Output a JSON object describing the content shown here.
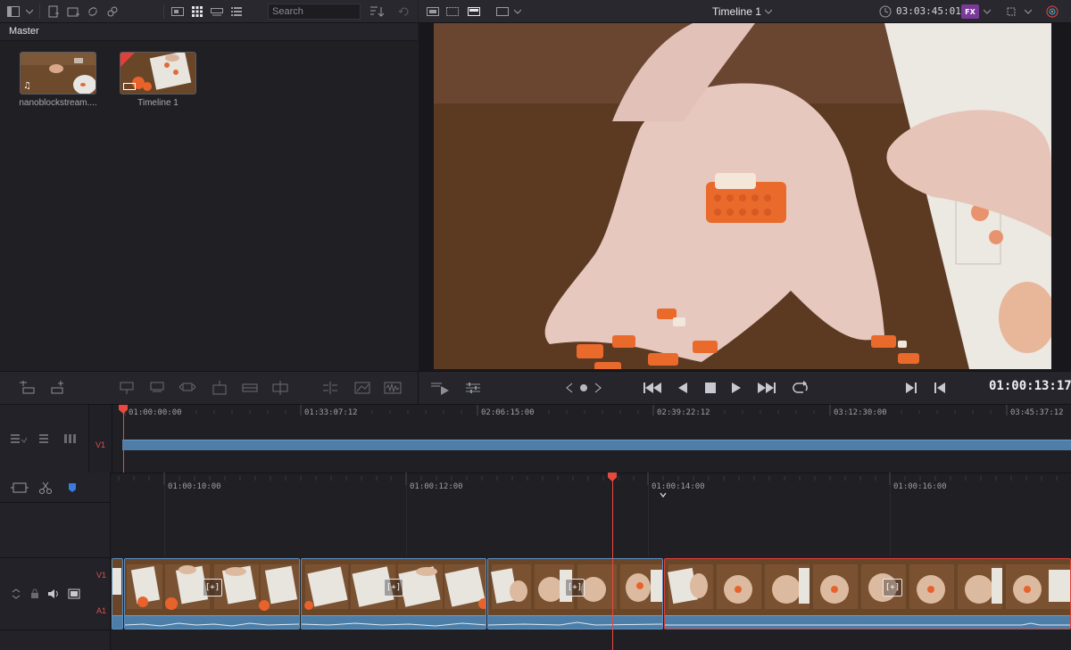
{
  "media_pool": {
    "search_placeholder": "Search",
    "bin_name": "Master",
    "items": [
      {
        "label": "nanoblockstream...."
      },
      {
        "label": "Timeline 1"
      }
    ]
  },
  "viewer": {
    "timeline_name": "Timeline 1",
    "source_timecode": "03:03:45:01",
    "current_timecode": "01:00:13:17"
  },
  "upper_timeline": {
    "track": "V1",
    "ruler": [
      "01:00:00:00",
      "01:33:07:12",
      "02:06:15:00",
      "02:39:22:12",
      "03:12:30:00",
      "03:45:37:12"
    ]
  },
  "lower_timeline": {
    "tracks": [
      "V1",
      "A1"
    ],
    "ruler": [
      "01:00:10:00",
      "01:00:12:00",
      "01:00:14:00",
      "01:00:16:00"
    ],
    "clips": [
      {
        "fx": "[+]"
      },
      {
        "fx": "[+]"
      },
      {
        "fx": "[+]"
      },
      {
        "fx": "[+]"
      }
    ]
  },
  "colors": {
    "accent_red": "#e8493e",
    "clip_blue": "#4f7fa8",
    "selected_clip": "#e0403a"
  }
}
